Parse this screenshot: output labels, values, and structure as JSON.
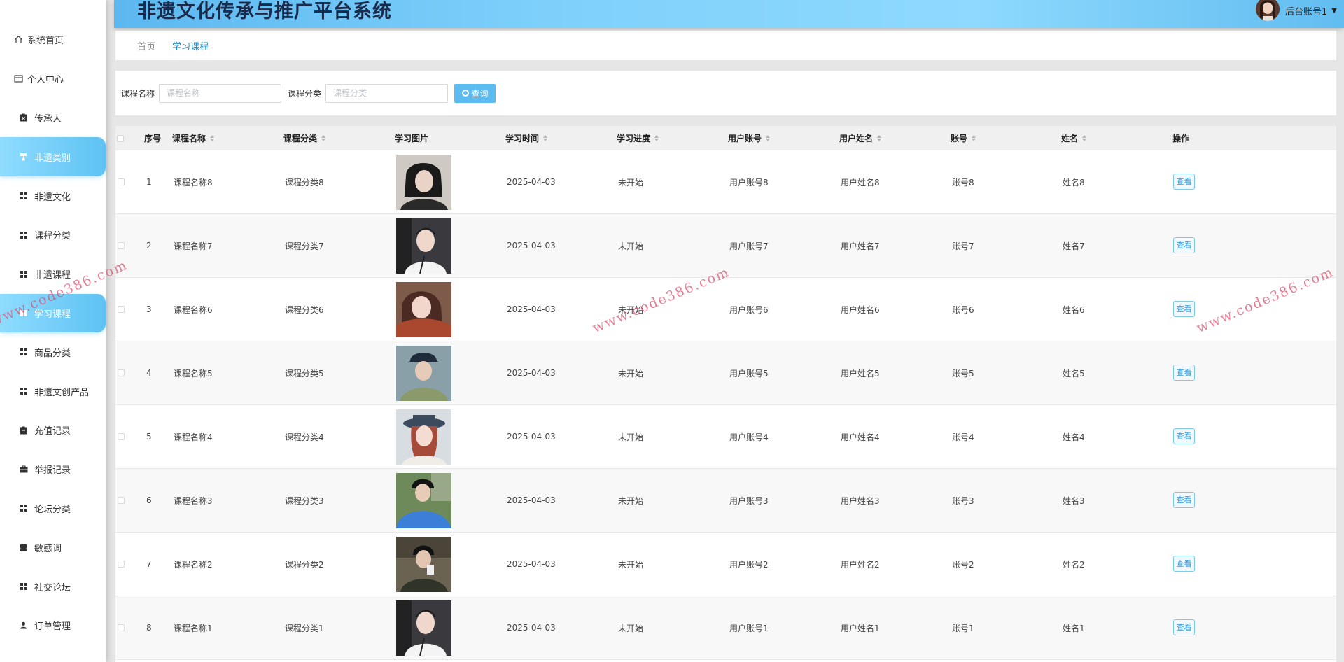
{
  "app": {
    "title": "非遗文化传承与推广平台系统"
  },
  "user": {
    "name": "后台账号1"
  },
  "sidebar": {
    "items": [
      {
        "label": "系统首页",
        "icon": "home-icon"
      },
      {
        "label": "个人中心",
        "icon": "profile-card-icon"
      },
      {
        "label": "传承人",
        "icon": "clipboard-x-icon"
      },
      {
        "label": "非遗类别",
        "icon": "paint-roller-icon",
        "active": true
      },
      {
        "label": "非遗文化",
        "icon": "grid-icon"
      },
      {
        "label": "课程分类",
        "icon": "grid-icon"
      },
      {
        "label": "非遗课程",
        "icon": "grid-icon"
      },
      {
        "label": "学习课程",
        "icon": "book-icon",
        "active": true
      },
      {
        "label": "商品分类",
        "icon": "grid-icon"
      },
      {
        "label": "非遗文创产品",
        "icon": "grid-icon"
      },
      {
        "label": "充值记录",
        "icon": "clipboard-icon"
      },
      {
        "label": "举报记录",
        "icon": "briefcase-icon"
      },
      {
        "label": "论坛分类",
        "icon": "grid-icon"
      },
      {
        "label": "敏感词",
        "icon": "stamp-icon"
      },
      {
        "label": "社交论坛",
        "icon": "grid-icon"
      },
      {
        "label": "订单管理",
        "icon": "user-icon"
      }
    ]
  },
  "breadcrumb": {
    "home": "首页",
    "current": "学习课程"
  },
  "search": {
    "course_name_label": "课程名称",
    "course_name_placeholder": "课程名称",
    "course_category_label": "课程分类",
    "course_category_placeholder": "课程分类",
    "button_label": "查询"
  },
  "table": {
    "headers": {
      "index": "序号",
      "course_name": "课程名称",
      "course_category": "课程分类",
      "study_image": "学习图片",
      "study_time": "学习时间",
      "study_progress": "学习进度",
      "user_account": "用户账号",
      "user_name": "用户姓名",
      "account": "账号",
      "name": "姓名",
      "actions": "操作"
    },
    "view_label": "查看",
    "rows": [
      {
        "index": "1",
        "course_name": "课程名称8",
        "course_category": "课程分类8",
        "study_time": "2025-04-03",
        "study_progress": "未开始",
        "user_account": "用户账号8",
        "user_name": "用户姓名8",
        "account": "账号8",
        "name": "姓名8"
      },
      {
        "index": "2",
        "course_name": "课程名称7",
        "course_category": "课程分类7",
        "study_time": "2025-04-03",
        "study_progress": "未开始",
        "user_account": "用户账号7",
        "user_name": "用户姓名7",
        "account": "账号7",
        "name": "姓名7"
      },
      {
        "index": "3",
        "course_name": "课程名称6",
        "course_category": "课程分类6",
        "study_time": "2025-04-03",
        "study_progress": "未开始",
        "user_account": "用户账号6",
        "user_name": "用户姓名6",
        "account": "账号6",
        "name": "姓名6"
      },
      {
        "index": "4",
        "course_name": "课程名称5",
        "course_category": "课程分类5",
        "study_time": "2025-04-03",
        "study_progress": "未开始",
        "user_account": "用户账号5",
        "user_name": "用户姓名5",
        "account": "账号5",
        "name": "姓名5"
      },
      {
        "index": "5",
        "course_name": "课程名称4",
        "course_category": "课程分类4",
        "study_time": "2025-04-03",
        "study_progress": "未开始",
        "user_account": "用户账号4",
        "user_name": "用户姓名4",
        "account": "账号4",
        "name": "姓名4"
      },
      {
        "index": "6",
        "course_name": "课程名称3",
        "course_category": "课程分类3",
        "study_time": "2025-04-03",
        "study_progress": "未开始",
        "user_account": "用户账号3",
        "user_name": "用户姓名3",
        "account": "账号3",
        "name": "姓名3"
      },
      {
        "index": "7",
        "course_name": "课程名称2",
        "course_category": "课程分类2",
        "study_time": "2025-04-03",
        "study_progress": "未开始",
        "user_account": "用户账号2",
        "user_name": "用户姓名2",
        "account": "账号2",
        "name": "姓名2"
      },
      {
        "index": "8",
        "course_name": "课程名称1",
        "course_category": "课程分类1",
        "study_time": "2025-04-03",
        "study_progress": "未开始",
        "user_account": "用户账号1",
        "user_name": "用户姓名1",
        "account": "账号1",
        "name": "姓名1"
      }
    ]
  },
  "watermark": "www.code386.com",
  "colors": {
    "accent": "#5cbcf0",
    "link": "#1e88c9",
    "header_start": "#5cb8ef",
    "header_end": "#8ed9fe"
  }
}
